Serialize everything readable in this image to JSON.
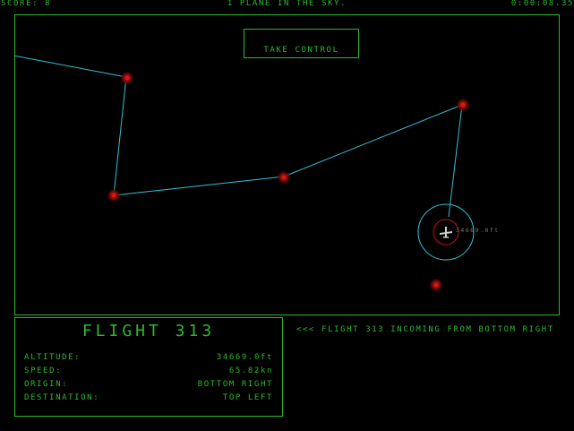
{
  "hud": {
    "score": "SCORE: 8",
    "planes_in_sky": "1 PLANE IN THE SKY.",
    "clock": "0:00:08.35"
  },
  "take_control_label": "TAKE CONTROL",
  "plane": {
    "altitude_label": "34669.0ft"
  },
  "info_panel": {
    "flight_title": "FLIGHT 313",
    "rows": [
      {
        "key": "ALTITUDE:",
        "value": "34669.0ft"
      },
      {
        "key": "SPEED:",
        "value": "65.82kn"
      },
      {
        "key": "ORIGIN:",
        "value": "BOTTOM RIGHT"
      },
      {
        "key": "DESTINATION:",
        "value": "TOP LEFT"
      }
    ]
  },
  "ticker": "<<< FLIGHT 313 INCOMING FROM BOTTOM RIGHT",
  "colors": {
    "hud_green": "#2db82d",
    "route_cyan": "#34c0d8",
    "waypoint_red": "#b01010",
    "background": "#000000"
  },
  "icons": {
    "plane": "airplane-icon",
    "waypoint": "waypoint-marker"
  }
}
